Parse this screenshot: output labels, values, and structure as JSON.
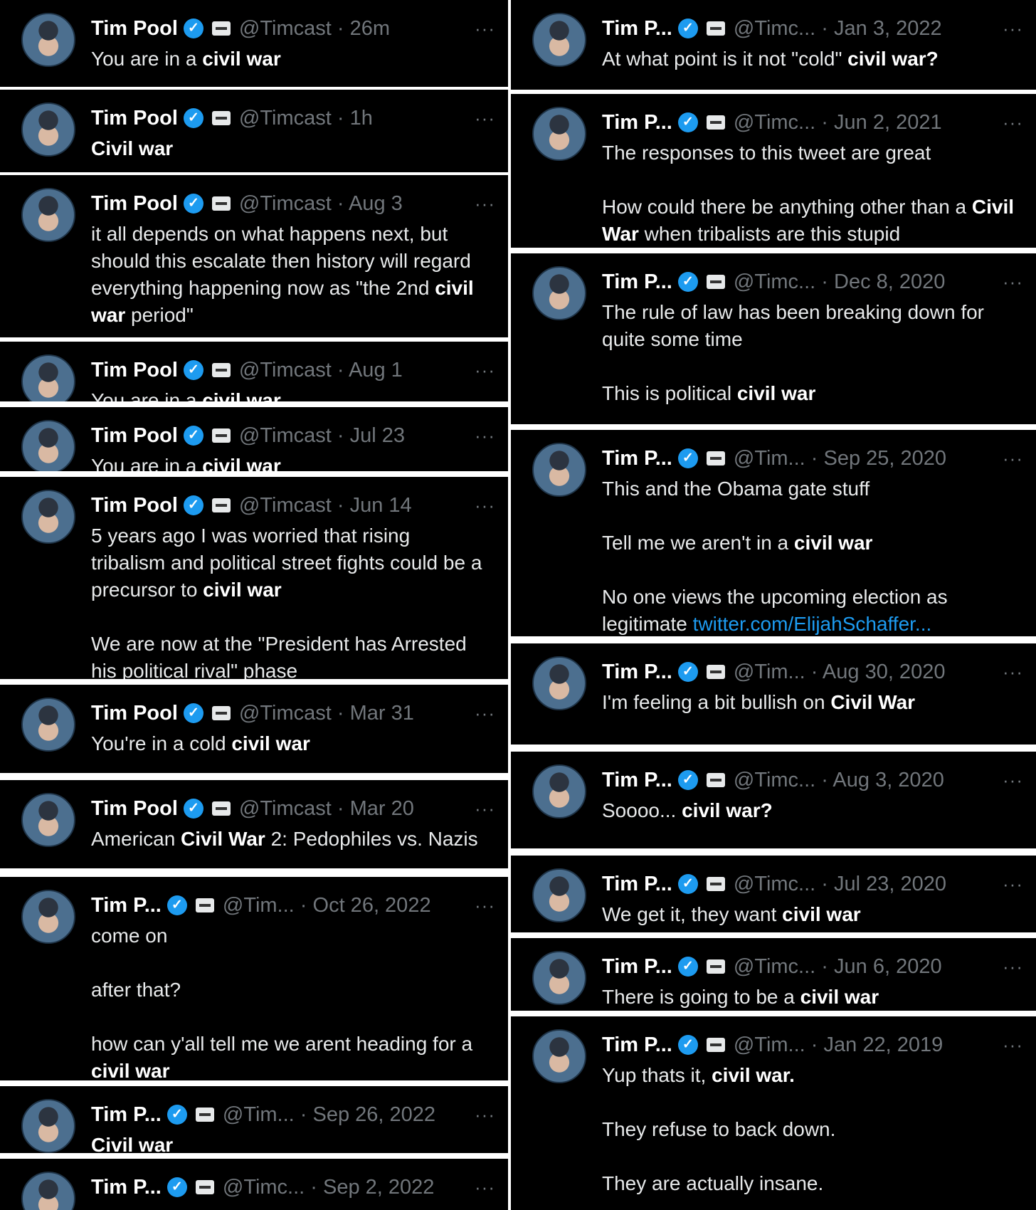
{
  "left_column": [
    {
      "name": "Tim Pool",
      "handle": "@Timcast",
      "time": "26m",
      "paragraphs": [
        [
          "You are in a ",
          [
            "civil war"
          ]
        ]
      ]
    },
    {
      "name": "Tim Pool",
      "handle": "@Timcast",
      "time": "1h",
      "paragraphs": [
        [
          [
            "Civil war"
          ]
        ]
      ]
    },
    {
      "name": "Tim Pool",
      "handle": "@Timcast",
      "time": "Aug 3",
      "paragraphs": [
        [
          "it all depends on what happens next, but should this escalate then history will regard everything happening now as \"the 2nd ",
          [
            "civil war"
          ],
          " period\""
        ]
      ]
    },
    {
      "name": "Tim Pool",
      "handle": "@Timcast",
      "time": "Aug 1",
      "paragraphs": [
        [
          "You are in a ",
          [
            "civil war"
          ]
        ]
      ]
    },
    {
      "name": "Tim Pool",
      "handle": "@Timcast",
      "time": "Jul 23",
      "paragraphs": [
        [
          "You are in a ",
          [
            "civil war"
          ]
        ]
      ]
    },
    {
      "name": "Tim Pool",
      "handle": "@Timcast",
      "time": "Jun 14",
      "paragraphs": [
        [
          "5 years ago I was worried that rising tribalism and political street fights could be a precursor to ",
          [
            "civil war"
          ]
        ],
        [
          "We are now at the \"President has Arrested his political rival\" phase"
        ]
      ]
    },
    {
      "name": "Tim Pool",
      "handle": "@Timcast",
      "time": "Mar 31",
      "paragraphs": [
        [
          "You're in a cold ",
          [
            "civil war"
          ]
        ]
      ]
    },
    {
      "name": "Tim Pool",
      "handle": "@Timcast",
      "time": "Mar 20",
      "paragraphs": [
        [
          "American ",
          [
            "Civil War"
          ],
          " 2: Pedophiles vs. Nazis"
        ]
      ]
    },
    {
      "name": "Tim P...",
      "handle": "@Tim...",
      "time": "Oct 26, 2022",
      "paragraphs": [
        [
          "come on"
        ],
        [
          "after that?"
        ],
        [
          "how can y'all tell me we arent heading for a ",
          [
            "civil war"
          ]
        ]
      ]
    },
    {
      "name": "Tim P...",
      "handle": "@Tim...",
      "time": "Sep 26, 2022",
      "paragraphs": [
        [
          [
            "Civil war"
          ]
        ]
      ]
    },
    {
      "name": "Tim P...",
      "handle": "@Timc...",
      "time": "Sep 2, 2022",
      "paragraphs": []
    }
  ],
  "right_column": [
    {
      "name": "Tim P...",
      "handle": "@Timc...",
      "time": "Jan 3, 2022",
      "paragraphs": [
        [
          "At what point is it not \"cold\" ",
          [
            "civil war?"
          ]
        ]
      ]
    },
    {
      "name": "Tim P...",
      "handle": "@Timc...",
      "time": "Jun 2, 2021",
      "paragraphs": [
        [
          "The responses to this tweet are great"
        ],
        [
          "How could there be anything other than a ",
          [
            "Civil War"
          ],
          " when tribalists are this stupid"
        ]
      ]
    },
    {
      "name": "Tim P...",
      "handle": "@Timc...",
      "time": "Dec 8, 2020",
      "paragraphs": [
        [
          "The rule of law has been breaking down for quite some time"
        ],
        [
          "This is political ",
          [
            "civil war"
          ]
        ]
      ]
    },
    {
      "name": "Tim P...",
      "handle": "@Tim...",
      "time": "Sep 25, 2020",
      "paragraphs": [
        [
          "This and the Obama gate stuff"
        ],
        [
          "Tell me we aren't in a ",
          [
            "civil war"
          ]
        ],
        [
          "No one views the upcoming election as legitimate ",
          {
            "link": "twitter.com/ElijahSchaffer..."
          }
        ]
      ]
    },
    {
      "name": "Tim P...",
      "handle": "@Tim...",
      "time": "Aug 30, 2020",
      "paragraphs": [
        [
          "I'm feeling a bit bullish on ",
          [
            "Civil War"
          ]
        ]
      ]
    },
    {
      "name": "Tim P...",
      "handle": "@Timc...",
      "time": "Aug 3, 2020",
      "paragraphs": [
        [
          "Soooo... ",
          [
            "civil war?"
          ]
        ]
      ]
    },
    {
      "name": "Tim P...",
      "handle": "@Timc...",
      "time": "Jul 23, 2020",
      "paragraphs": [
        [
          "We get it, they want ",
          [
            "civil war"
          ]
        ]
      ]
    },
    {
      "name": "Tim P...",
      "handle": "@Timc...",
      "time": "Jun 6, 2020",
      "paragraphs": [
        [
          "There is going to be a ",
          [
            "civil war"
          ]
        ]
      ]
    },
    {
      "name": "Tim P...",
      "handle": "@Tim...",
      "time": "Jan 22, 2019",
      "paragraphs": [
        [
          "Yup thats it, ",
          [
            "civil war."
          ]
        ],
        [
          "They refuse to back down."
        ],
        [
          "They are actually insane."
        ]
      ]
    }
  ],
  "ui": {
    "verified_glyph": "✓",
    "more_glyph": "···",
    "separator": " · "
  },
  "colors": {
    "background": "#000000",
    "text": "#e7e9ea",
    "muted": "#71767b",
    "verified": "#1d9bf0",
    "link": "#1d9bf0",
    "divider": "#ffffff"
  }
}
